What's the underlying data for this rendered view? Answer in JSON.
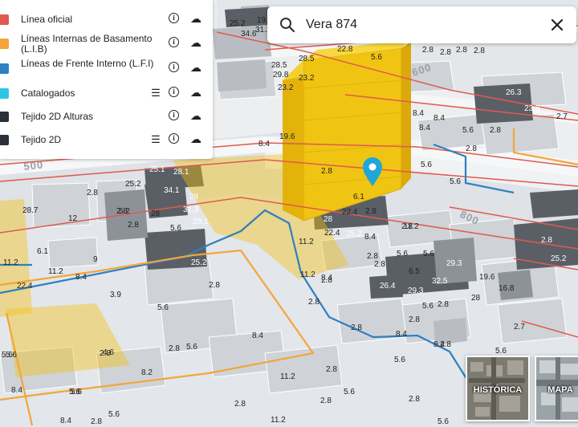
{
  "search": {
    "value": "Vera 874"
  },
  "legend": [
    {
      "label": "Línea oficial",
      "color": "#e05a4f",
      "has_list": false
    },
    {
      "label": "Líneas Internas de Basamento (L.I.B)",
      "color": "#f3a53b",
      "has_list": false
    },
    {
      "label": "Líneas de Frente Interno (L.F.I)",
      "color": "#2f7fc1",
      "has_list": false
    },
    {
      "label": "Catalogados",
      "color": "#2ec5e6",
      "has_list": true
    },
    {
      "label": "Tejido 2D Alturas",
      "color": "#2b2f36",
      "has_list": false
    },
    {
      "label": "Tejido 2D",
      "color": "#2b2f36",
      "has_list": true
    }
  ],
  "basemaps": [
    {
      "label": "HISTÓRICA"
    },
    {
      "label": "MAPA"
    }
  ],
  "streets": [
    "500",
    "600",
    "800"
  ],
  "colors": {
    "highlight": "#f2c20f",
    "pin": "#1ea7d7"
  },
  "height_labels": [
    "19.6",
    "19.6",
    "25.2",
    "34.6",
    "31.2",
    "28.5",
    "29.8",
    "23.2",
    "28.5",
    "23.2",
    "22.8",
    "5.6",
    "2.8",
    "2.8",
    "2.8",
    "2.8",
    "26.3",
    "23.8",
    "8.4",
    "8.4",
    "8.4",
    "5.6",
    "2.8",
    "2.8",
    "5.6",
    "2.7",
    "5.6",
    "8.4",
    "19.6",
    "25.1",
    "28.1",
    "25.2",
    "2.8",
    "6.1",
    "34.1",
    "28",
    "31.3",
    "2.8",
    "28",
    "28.1",
    "28.7",
    "12",
    "5.2",
    "2.8",
    "2.8",
    "5.6",
    "2.8",
    "28",
    "25.2",
    "2.8",
    "22.4",
    "22.4",
    "11.2",
    "8.4",
    "2.8",
    "11.2",
    "11.2",
    "8.4",
    "5.6",
    "6.5",
    "5.6",
    "2.8",
    "25.2",
    "29.3",
    "19.6",
    "26.4",
    "32.5",
    "29.3",
    "16.8",
    "28",
    "2.8",
    "2.8",
    "2.8",
    "9",
    "8.4",
    "11.2",
    "3.9",
    "5.6",
    "2.8",
    "5.6",
    "2.8",
    "8.4",
    "2.8",
    "5.6",
    "2.8",
    "4.6",
    "5.6",
    "8.4",
    "8.2",
    "2.8",
    "5.6",
    "11.2",
    "5.6",
    "2.8",
    "2.8",
    "5.6",
    "2.8",
    "11.2",
    "8.4",
    "2.8",
    "5.6",
    "5.6",
    "2.8",
    "2.8",
    "25.2",
    "22.4",
    "6.1",
    "8.4",
    "5.6",
    "5.6",
    "8.4",
    "2.8",
    "11.2",
    "2.7",
    "5.6"
  ]
}
